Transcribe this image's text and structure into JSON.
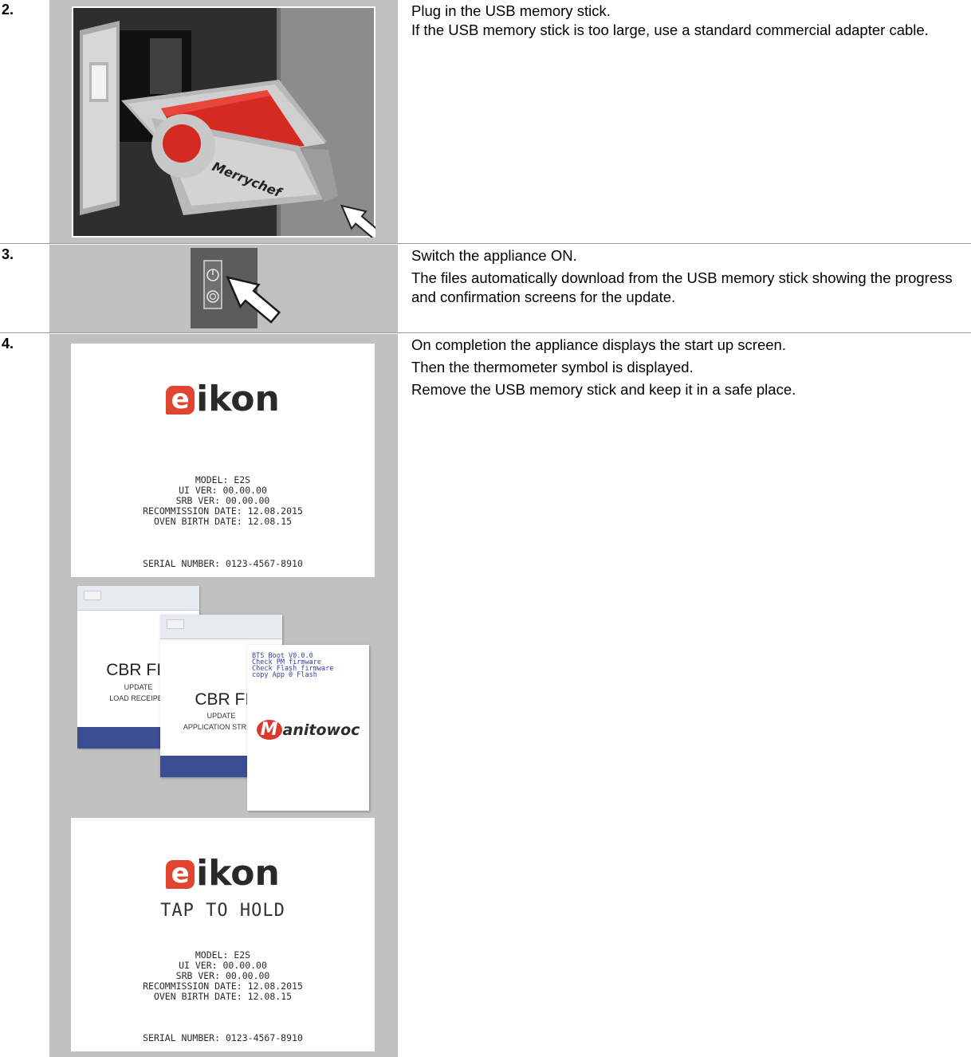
{
  "steps": [
    {
      "number": "2.",
      "lines": [
        "Plug in the USB memory stick.",
        "If the USB memory stick is too large, use a standard commercial adapter cable."
      ],
      "image": {
        "usb_brand": "Merrychef"
      }
    },
    {
      "number": "3.",
      "lines": [
        "Switch the appliance ON.",
        "The files automatically download from the USB memory stick showing the progress and confirmation screens for the update."
      ]
    },
    {
      "number": "4.",
      "lines": [
        "On completion the appliance displays the start up screen.",
        "Then the thermometer symbol is displayed.",
        "Remove the USB memory stick and keep it in a safe place."
      ]
    }
  ],
  "startup_screen": {
    "brand": "eikon",
    "brand_letter": "e",
    "brand_rest": "ikon",
    "info_lines": [
      "MODEL: E2S",
      "UI VER: 00.00.00",
      "SRB VER: 00.00.00",
      "RECOMMISSION DATE: 12.08.2015",
      "OVEN BIRTH DATE: 12.08.15"
    ],
    "serial": "SERIAL NUMBER: 0123-4567-8910",
    "tap_to_hold": "TAP TO HOLD"
  },
  "update_screens": {
    "screen1": {
      "title": "CBR FIL",
      "sub1": "UPDATE",
      "sub2": "LOAD RECEIPES"
    },
    "screen2": {
      "title": "CBR FILI",
      "sub1": "UPDATE",
      "sub2": "APPLICATION STRING"
    },
    "screen3": {
      "boot_lines": [
        "BTS Boot V0.0.0",
        "Check PM firmware",
        "Check Flash firmware",
        "copy App 0 Flash"
      ],
      "logo": "Manitowoc",
      "logo_letter": "M",
      "logo_rest": "anitowoc"
    }
  },
  "colors": {
    "eikon_red": "#e0452f",
    "usb_red": "#d42a22",
    "manitowoc_red": "#d93a2b",
    "update_blue": "#3c4d93",
    "image_cell_bg": "#c1c1c1"
  }
}
